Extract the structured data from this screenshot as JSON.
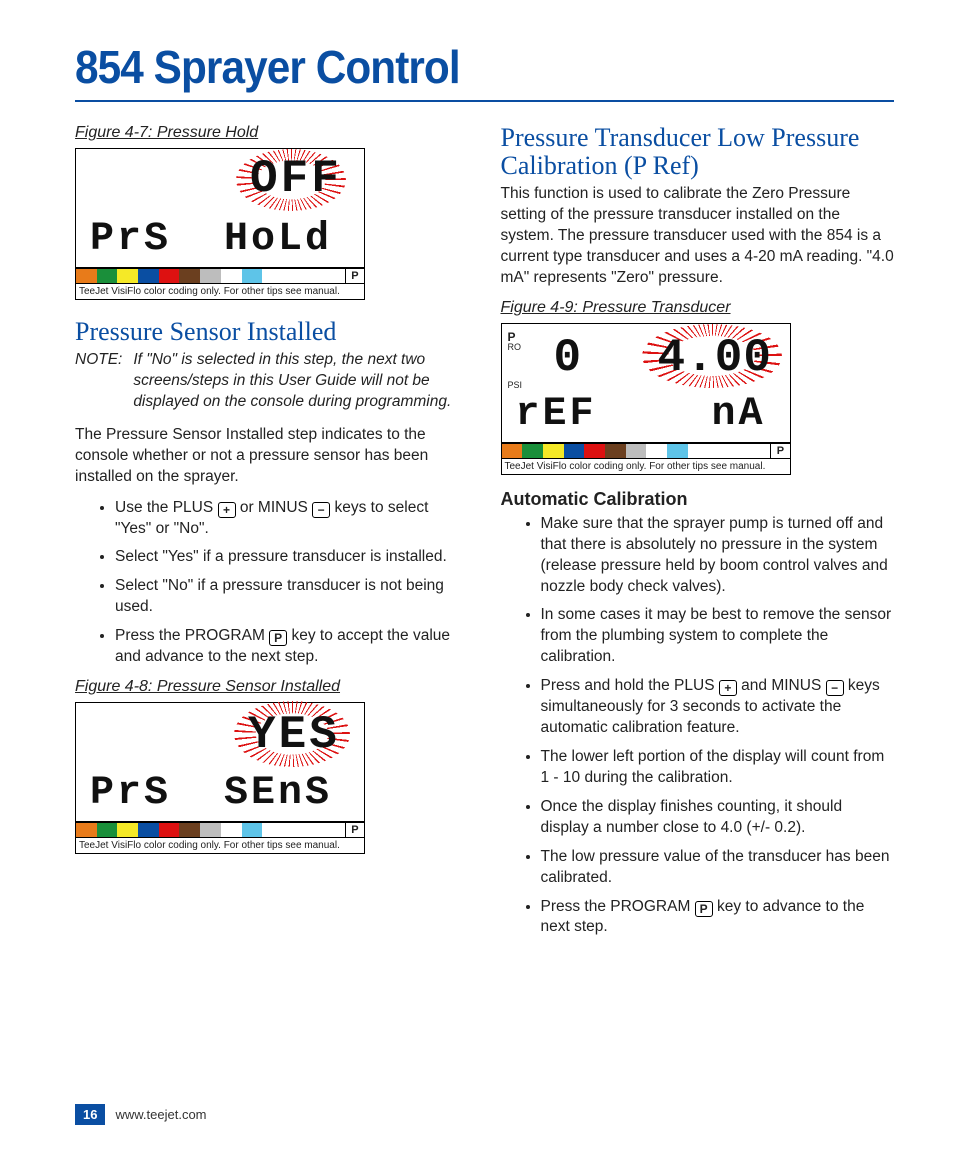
{
  "title": "854 Sprayer Control",
  "footer": {
    "page": "16",
    "url": "www.teejet.com"
  },
  "colorbar": {
    "colors": [
      "#e87b1a",
      "#1a8f3a",
      "#f5e927",
      "#0a4ea2",
      "#d11",
      "#6b3f1f",
      "#bdbdbd",
      "#ffffff",
      "#5ec4e8",
      "#ffffff",
      "#ffffff",
      "#ffffff",
      "#ffffff"
    ],
    "p_label": "P",
    "note": "TeeJet VisiFlo color coding only. For other tips see manual."
  },
  "keys": {
    "plus": "+",
    "minus": "−",
    "program": "P"
  },
  "left": {
    "fig47_caption": "Figure 4-7: Pressure Hold",
    "fig47": {
      "top": "OFF",
      "bl": "PrS",
      "br": "HoLd"
    },
    "h2": "Pressure Sensor Installed",
    "note_label": "NOTE:",
    "note_body": "If \"No\" is selected in this step, the next two screens/steps in this User Guide will not be displayed on the console during programming.",
    "para": "The Pressure Sensor Installed step indicates to the console whether or not a pressure sensor has been installed on the sprayer.",
    "bullets": [
      {
        "pre": "Use the PLUS ",
        "key1": "plus",
        "mid": " or MINUS ",
        "key2": "minus",
        "post": " keys to select \"Yes\" or \"No\"."
      },
      {
        "pre": "Select \"Yes\" if a pressure transducer is installed.",
        "key1": null
      },
      {
        "pre": "Select \"No\" if a pressure transducer is not being used.",
        "key1": null
      },
      {
        "pre": "Press the PROGRAM ",
        "key1": "program",
        "post": " key to accept the value and advance to the next step."
      }
    ],
    "fig48_caption": "Figure 4-8: Pressure Sensor Installed",
    "fig48": {
      "top": "YES",
      "bl": "PrS",
      "br": "SEnS"
    }
  },
  "right": {
    "h2": "Pressure Transducer Low Pressure Calibration (P Ref)",
    "para": "This function is used to calibrate the Zero Pressure setting of the pressure transducer installed on the system. The pressure transducer used with the 854 is a current type transducer and uses a 4-20 mA reading. \"4.0 mA\" represents \"Zero\" pressure.",
    "fig49_caption": "Figure 4-9: Pressure Transducer",
    "fig49": {
      "ind1": "P",
      "ind1b": "RO",
      "ind2": "PSI",
      "tl": "0",
      "tr": "4.00",
      "bl": "rEF",
      "br": "nA"
    },
    "h3": "Automatic Calibration",
    "bullets": [
      {
        "pre": "Make sure that the sprayer pump is turned off and that there is absolutely no pressure in the system (release pressure held by boom control valves and nozzle body check valves).",
        "key1": null
      },
      {
        "pre": "In some cases it may be best to remove the sensor from the plumbing system to complete the calibration.",
        "key1": null
      },
      {
        "pre": "Press and hold the PLUS ",
        "key1": "plus",
        "mid": " and MINUS ",
        "key2": "minus",
        "post": " keys simultaneously for 3 seconds to activate the automatic calibration feature."
      },
      {
        "pre": "The lower left portion of the display will count from 1 - 10 during the calibration.",
        "key1": null
      },
      {
        "pre": "Once the display finishes counting, it should display a number close to 4.0 (+/- 0.2).",
        "key1": null
      },
      {
        "pre": "The low pressure value of the transducer has been calibrated.",
        "key1": null
      },
      {
        "pre": "Press the PROGRAM ",
        "key1": "program",
        "post": " key to advance to the next step."
      }
    ]
  }
}
